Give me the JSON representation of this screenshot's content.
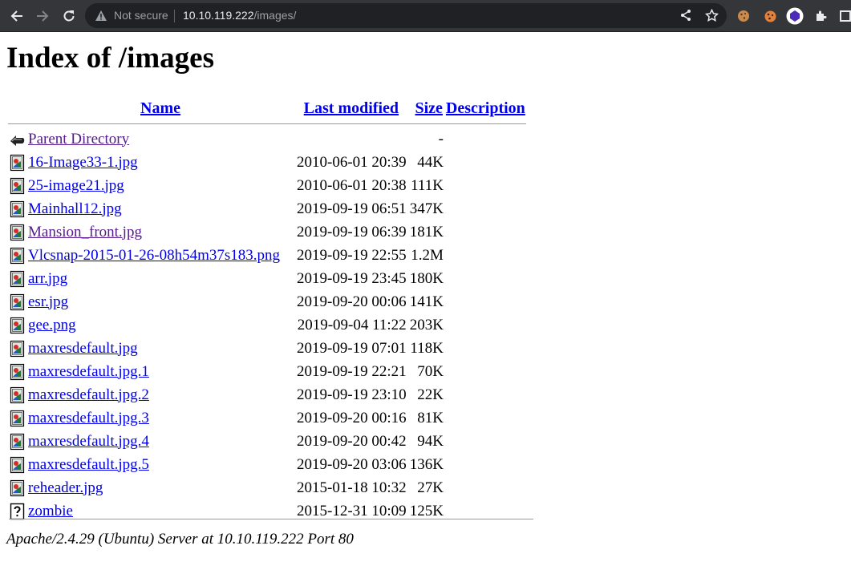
{
  "browser": {
    "security_label": "Not secure",
    "url_host": "10.10.119.222",
    "url_path": "/images/"
  },
  "page": {
    "title": "Index of /images",
    "headers": {
      "name": "Name",
      "last_modified": "Last modified",
      "size": "Size",
      "description": "Description"
    },
    "parent": {
      "label": "Parent Directory",
      "size": "-"
    },
    "rows": [
      {
        "name": "16-Image33-1.jpg",
        "date": "2010-06-01 20:39",
        "size": "44K",
        "icon": "image-file-icon"
      },
      {
        "name": "25-image21.jpg",
        "date": "2010-06-01 20:38",
        "size": "111K",
        "icon": "image-file-icon"
      },
      {
        "name": "Mainhall12.jpg",
        "date": "2019-09-19 06:51",
        "size": "347K",
        "icon": "image-file-icon"
      },
      {
        "name": "Mansion_front.jpg",
        "date": "2019-09-19 06:39",
        "size": "181K",
        "icon": "image-file-icon",
        "visited": true
      },
      {
        "name": "Vlcsnap-2015-01-26-08h54m37s183.png",
        "date": "2019-09-19 22:55",
        "size": "1.2M",
        "icon": "image-file-icon"
      },
      {
        "name": "arr.jpg",
        "date": "2019-09-19 23:45",
        "size": "180K",
        "icon": "image-file-icon"
      },
      {
        "name": "esr.jpg",
        "date": "2019-09-20 00:06",
        "size": "141K",
        "icon": "image-file-icon"
      },
      {
        "name": "gee.png",
        "date": "2019-09-04 11:22",
        "size": "203K",
        "icon": "image-file-icon"
      },
      {
        "name": "maxresdefault.jpg",
        "date": "2019-09-19 07:01",
        "size": "118K",
        "icon": "image-file-icon"
      },
      {
        "name": "maxresdefault.jpg.1",
        "date": "2019-09-19 22:21",
        "size": "70K",
        "icon": "image-file-icon"
      },
      {
        "name": "maxresdefault.jpg.2",
        "date": "2019-09-19 23:10",
        "size": "22K",
        "icon": "image-file-icon"
      },
      {
        "name": "maxresdefault.jpg.3",
        "date": "2019-09-20 00:16",
        "size": "81K",
        "icon": "image-file-icon"
      },
      {
        "name": "maxresdefault.jpg.4",
        "date": "2019-09-20 00:42",
        "size": "94K",
        "icon": "image-file-icon"
      },
      {
        "name": "maxresdefault.jpg.5",
        "date": "2019-09-20 03:06",
        "size": "136K",
        "icon": "image-file-icon"
      },
      {
        "name": "reheader.jpg",
        "date": "2015-01-18 10:32",
        "size": "27K",
        "icon": "image-file-icon"
      },
      {
        "name": "zombie",
        "date": "2015-12-31 10:09",
        "size": "125K",
        "icon": "unknown-file-icon"
      }
    ],
    "footer": "Apache/2.4.29 (Ubuntu) Server at 10.10.119.222 Port 80"
  },
  "colors": {
    "link": "#0000ee",
    "visited_link": "#551a8b",
    "chrome_bg": "#35363a",
    "omnibox_bg": "#202124"
  }
}
